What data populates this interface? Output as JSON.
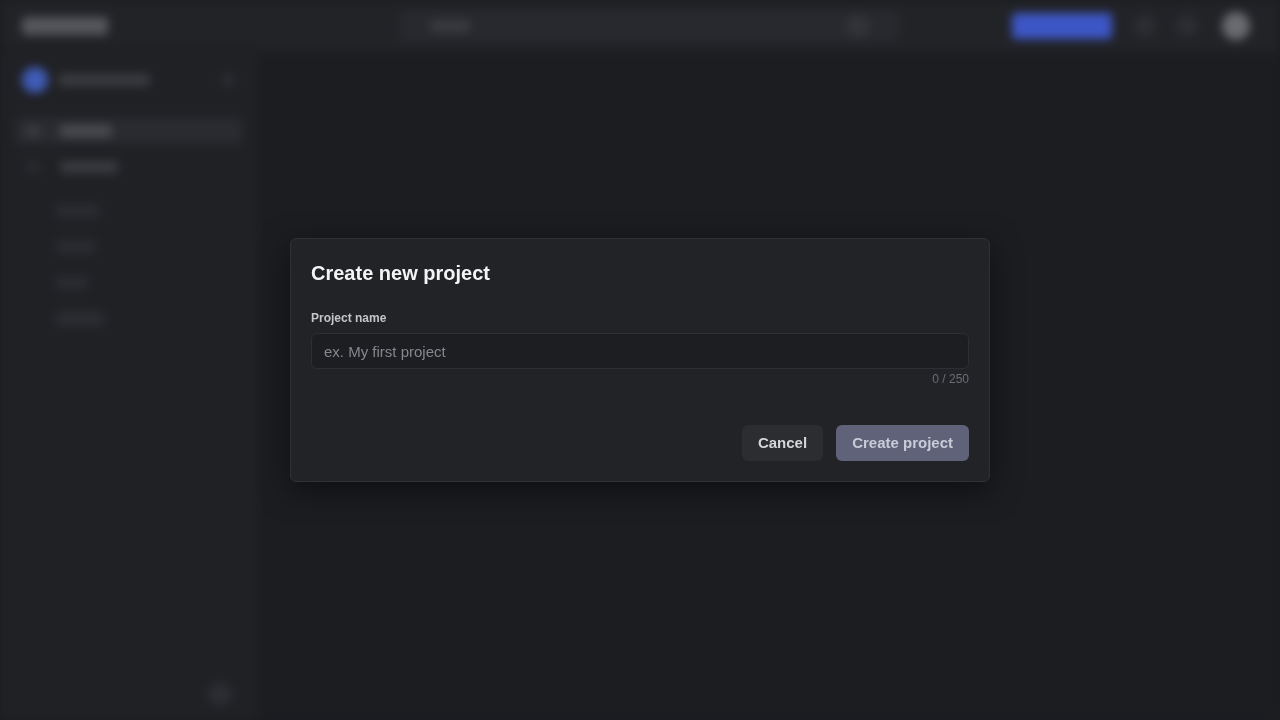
{
  "dialog": {
    "title": "Create new project",
    "field": {
      "label": "Project name",
      "placeholder": "ex. My first project",
      "counter": "0 / 250"
    },
    "buttons": [
      {
        "label": "Cancel",
        "kind": "secondary",
        "disabled": false
      },
      {
        "label": "Create project",
        "kind": "primary",
        "disabled": true
      }
    ]
  }
}
